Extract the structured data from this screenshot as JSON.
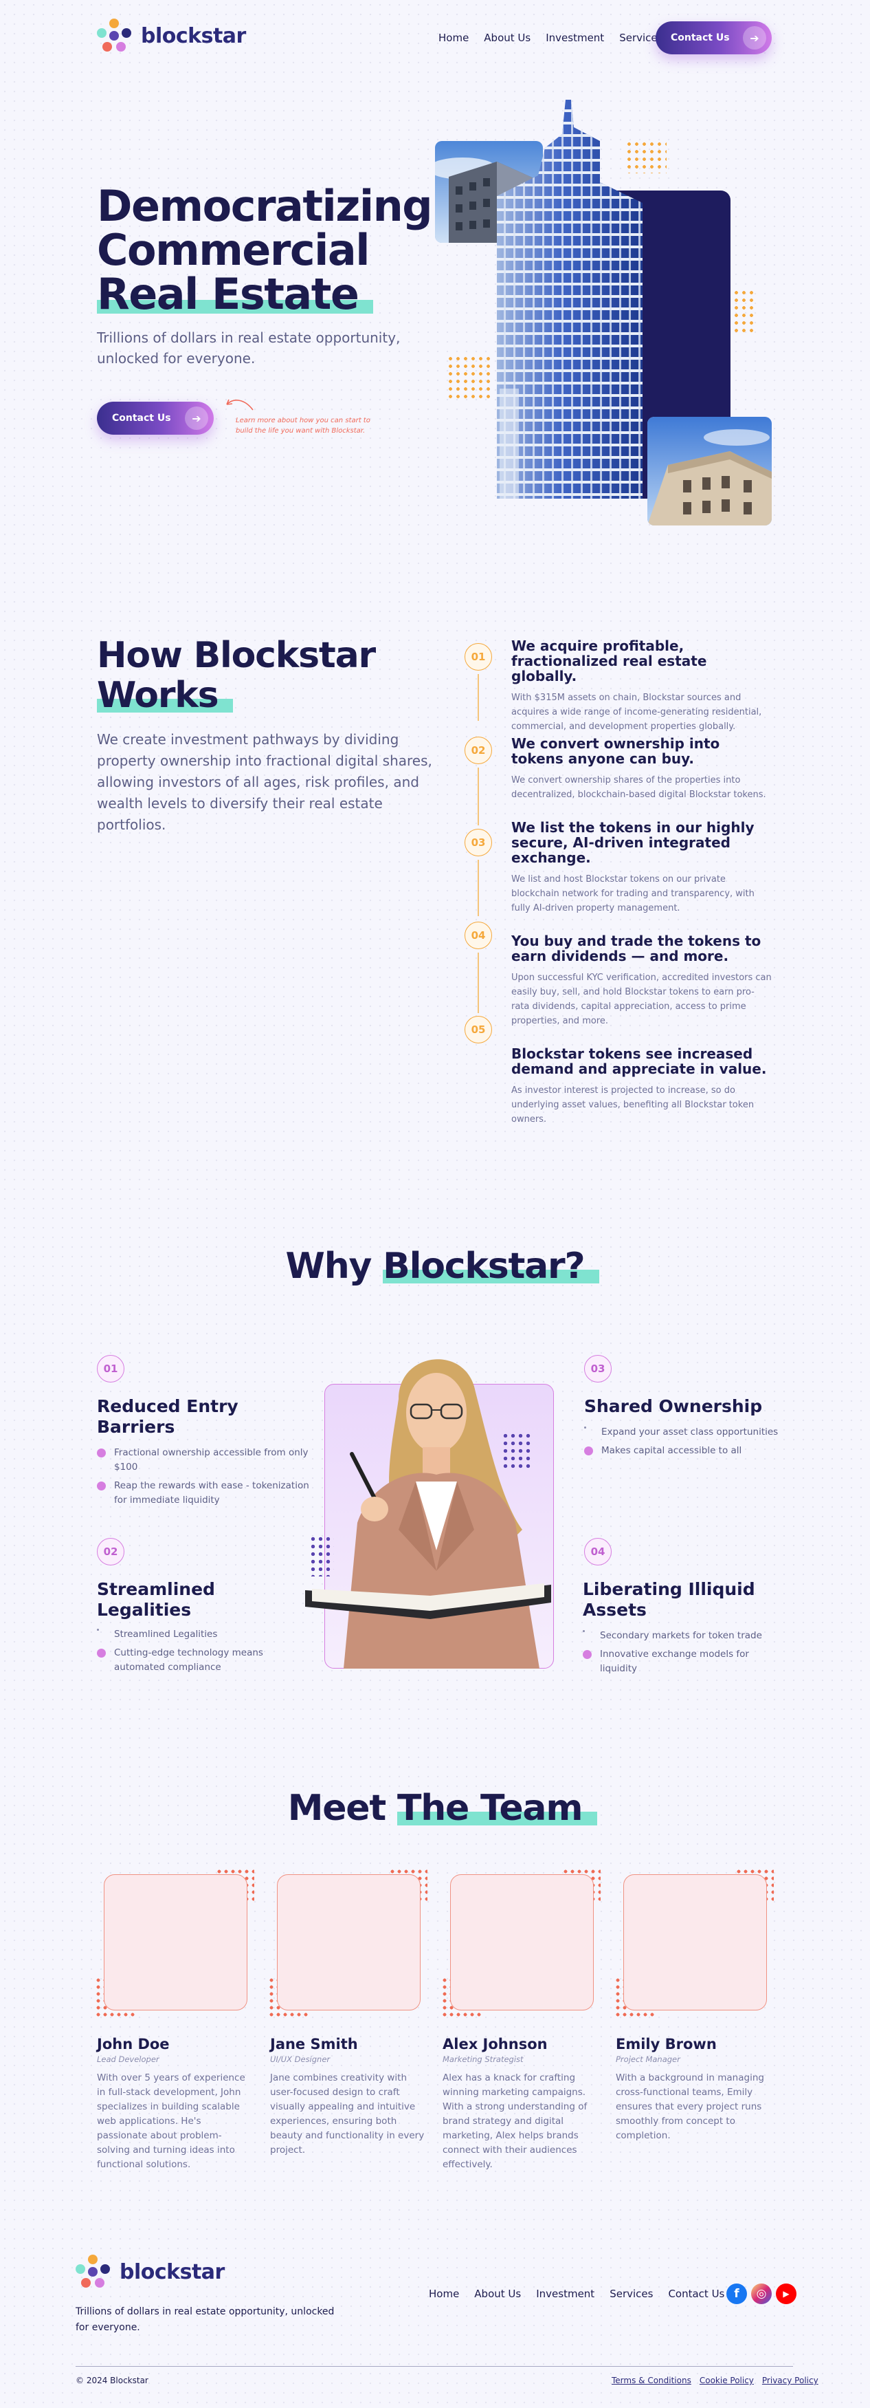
{
  "brand": {
    "name": "blockstar",
    "colors": {
      "navy": "#1c1b4d",
      "accent_teal": "#7fe3d0",
      "orange": "#f5a83b",
      "pink": "#d67ee0",
      "coral": "#f06a5a"
    }
  },
  "nav": {
    "items": [
      "Home",
      "About Us",
      "Investment",
      "Services"
    ],
    "cta": "Contact Us"
  },
  "hero": {
    "title_line1": "Democratizing",
    "title_line2": "Commercial",
    "title_line3": "Real Estate",
    "subtitle": "Trillions of dollars in real estate opportunity, unlocked for everyone.",
    "cta": "Contact Us",
    "note": "Learn more about how you can start to build the life you want with Blockstar."
  },
  "how": {
    "title_line1": "How Blockstar",
    "title_line2": "Works",
    "description": "We create investment pathways by dividing property ownership into fractional digital shares, allowing investors of all ages, risk profiles, and wealth levels to diversify their real estate portfolios.",
    "steps": [
      {
        "num": "01",
        "title": "We acquire profitable, fractionalized real estate globally.",
        "text": "With $315M assets on chain, Blockstar sources and acquires a wide range of income-generating residential, commercial, and development properties globally."
      },
      {
        "num": "02",
        "title": "We convert ownership into tokens anyone can buy.",
        "text": "We convert ownership shares of the properties into decentralized, blockchain-based digital Blockstar tokens."
      },
      {
        "num": "03",
        "title": "We list the tokens in our highly secure, AI-driven integrated exchange.",
        "text": "We list and host Blockstar tokens on our private blockchain network for trading and transparency, with fully AI-driven property management."
      },
      {
        "num": "04",
        "title": "You buy and trade the tokens to earn dividends — and more.",
        "text": "Upon successful KYC verification, accredited investors can easily buy, sell, and hold Blockstar tokens to earn pro-rata dividends, capital appreciation, access to prime properties, and more."
      },
      {
        "num": "05",
        "title": "Blockstar tokens see increased demand and appreciate in value.",
        "text": "As investor interest is projected to increase, so do underlying asset values, benefiting all Blockstar token owners."
      }
    ]
  },
  "why": {
    "title_plain": "Why",
    "title_hl": "Blockstar?",
    "features": [
      {
        "num": "01",
        "title": "Reduced Entry Barriers",
        "points": [
          "Fractional ownership accessible from only $100",
          "Reap the rewards with ease - tokenization for immediate liquidity"
        ]
      },
      {
        "num": "02",
        "title": "Streamlined Legalities",
        "points": [
          "Streamlined Legalities",
          "Cutting-edge technology means automated compliance"
        ]
      },
      {
        "num": "03",
        "title": "Shared Ownership",
        "points": [
          "Expand your asset class opportunities",
          "Makes capital accessible to all"
        ]
      },
      {
        "num": "04",
        "title": "Liberating Illiquid Assets",
        "points": [
          "Secondary markets for token trade",
          "Innovative exchange models for liquidity"
        ]
      }
    ]
  },
  "team": {
    "title_plain": "Meet",
    "title_hl": "The Team",
    "members": [
      {
        "name": "John Doe",
        "role": "Lead Developer",
        "bio": "With over 5 years of experience in full-stack development, John specializes in building scalable web applications. He's passionate about problem-solving and turning ideas into functional solutions."
      },
      {
        "name": "Jane Smith",
        "role": "UI/UX Designer",
        "bio": "Jane combines creativity with user-focused design to craft visually appealing and intuitive experiences, ensuring both beauty and functionality in every project."
      },
      {
        "name": "Alex Johnson",
        "role": "Marketing Strategist",
        "bio": "Alex has a knack for crafting winning marketing campaigns. With a strong understanding of brand strategy and digital marketing, Alex helps brands connect with their audiences effectively."
      },
      {
        "name": "Emily Brown",
        "role": "Project Manager",
        "bio": "With a background in managing cross-functional teams, Emily ensures that every project runs smoothly from concept to completion."
      }
    ]
  },
  "footer": {
    "tagline": "Trillions of dollars in real estate opportunity, unlocked for everyone.",
    "nav": [
      "Home",
      "About Us",
      "Investment",
      "Services",
      "Contact Us"
    ],
    "social": [
      {
        "icon": "facebook-icon",
        "glyph": "f",
        "color": "#1877f2"
      },
      {
        "icon": "instagram-icon",
        "glyph": "◎",
        "color": "#d6249f"
      },
      {
        "icon": "youtube-icon",
        "glyph": "▶",
        "color": "#ff0000"
      }
    ],
    "copyright": "© 2024 Blockstar",
    "links": [
      "Terms & Conditions",
      "Cookie Policy",
      "Privacy Policy"
    ]
  }
}
